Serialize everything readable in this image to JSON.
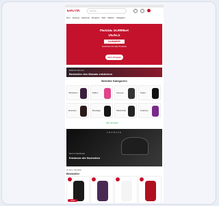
{
  "header": {
    "logo": "EROTIK",
    "search_placeholder": "Suchen..."
  },
  "nav": {
    "items": [
      "Neu",
      "Sextoys",
      "Dessous",
      "Drogerie",
      "Sale",
      "Marken",
      "Ratgeber"
    ]
  },
  "hero": {
    "title_line1": "HEISSE SOMMER",
    "title_line2": "DEALS",
    "code": "SUMMER",
    "subtitle": "Gutschein für alle Produkte",
    "button": "Jetzt shoppen"
  },
  "promo": {
    "line1": "Exklusiv bei uns",
    "line2": "Bestseller des Monats entdecken"
  },
  "categories": {
    "title": "Beliebte Kategorien",
    "items": [
      "Vibratoren",
      "Dildos",
      "Sextoys",
      "Paare",
      "Dessous",
      "Bondage",
      "Masturbator",
      "Analtoys"
    ]
  },
  "more_link": "Alle anzeigen",
  "dark_banner": {
    "brand": "ARCWAVE",
    "line1": "Neu im Sortiment",
    "line2": "Entdecke die Neuheiten"
  },
  "bestseller": {
    "label": "Unsere Topseller",
    "title": "Bestseller",
    "badge": "-20%"
  },
  "colors": {
    "brand_red": "#c8102e",
    "hero_red": "#c4122c",
    "green_link": "#2a9d4b"
  }
}
